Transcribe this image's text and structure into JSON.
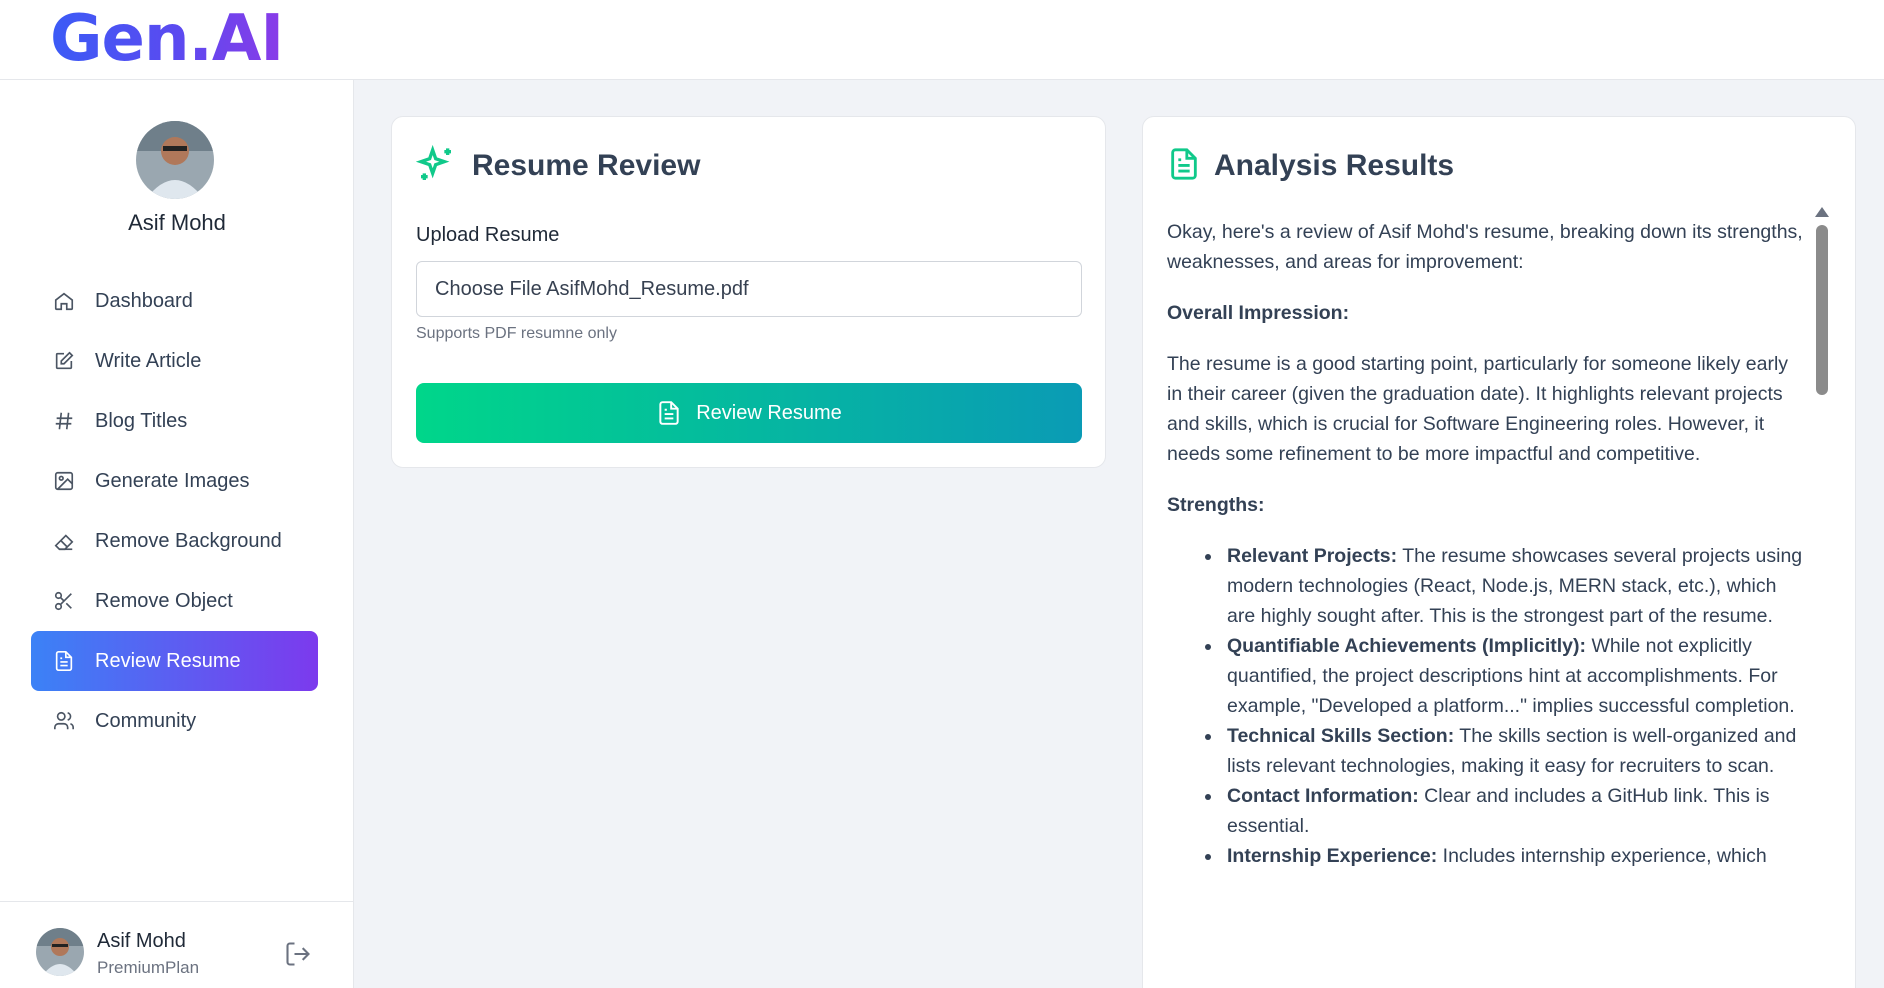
{
  "brand": {
    "logo": "Gen.AI"
  },
  "user": {
    "name": "Asif Mohd",
    "plan": "PremiumPlan"
  },
  "sidebar": {
    "items": [
      {
        "label": "Dashboard",
        "icon": "home-icon",
        "active": false
      },
      {
        "label": "Write Article",
        "icon": "edit-icon",
        "active": false
      },
      {
        "label": "Blog Titles",
        "icon": "hash-icon",
        "active": false
      },
      {
        "label": "Generate Images",
        "icon": "image-icon",
        "active": false
      },
      {
        "label": "Remove Background",
        "icon": "eraser-icon",
        "active": false
      },
      {
        "label": "Remove Object",
        "icon": "scissors-icon",
        "active": false
      },
      {
        "label": "Review Resume",
        "icon": "file-text-icon",
        "active": true
      },
      {
        "label": "Community",
        "icon": "users-icon",
        "active": false
      }
    ]
  },
  "review_card": {
    "title": "Resume Review",
    "upload_label": "Upload Resume",
    "file_input": "Choose File AsifMohd_Resume.pdf",
    "hint": "Supports PDF resumne only",
    "button_label": "Review Resume"
  },
  "results_card": {
    "title": "Analysis Results",
    "intro": "Okay, here's a review of Asif Mohd's resume, breaking down its strengths, weaknesses, and areas for improvement:",
    "overall_heading": "Overall Impression:",
    "overall_text": "The resume is a good starting point, particularly for someone likely early in their career (given the graduation date). It highlights relevant projects and skills, which is crucial for Software Engineering roles. However, it needs some refinement to be more impactful and competitive.",
    "strengths_heading": "Strengths:",
    "strengths": [
      {
        "bold": "Relevant Projects:",
        "text": " The resume showcases several projects using modern technologies (React, Node.js, MERN stack, etc.), which are highly sought after. This is the strongest part of the resume."
      },
      {
        "bold": "Quantifiable Achievements (Implicitly):",
        "text": " While not explicitly quantified, the project descriptions hint at accomplishments. For example, \"Developed a platform...\" implies successful completion."
      },
      {
        "bold": "Technical Skills Section:",
        "text": " The skills section is well-organized and lists relevant technologies, making it easy for recruiters to scan."
      },
      {
        "bold": "Contact Information:",
        "text": " Clear and includes a GitHub link. This is essential."
      },
      {
        "bold": "Internship Experience:",
        "text": " Includes internship experience, which"
      }
    ]
  },
  "colors": {
    "active_start": "#3b82f6",
    "active_end": "#7c3aed",
    "button_start": "#00d68a",
    "button_end": "#0a9bb5"
  }
}
